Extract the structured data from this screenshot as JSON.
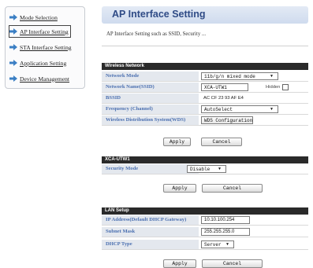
{
  "sidebar": {
    "items": [
      {
        "label": "Mode Selection"
      },
      {
        "label": "AP Interface Setting"
      },
      {
        "label": "STA Interface Setting"
      },
      {
        "label": "Application Setting"
      },
      {
        "label": "Device Management"
      }
    ]
  },
  "main": {
    "title": "AP Interface Setting",
    "description": "AP Interface Setting such as SSID, Security ..."
  },
  "wireless": {
    "header": "Wireless Network",
    "mode_label": "Network Mode",
    "mode_value": "11b/g/n mixed mode",
    "ssid_label": "Network Name(SSID)",
    "ssid_value": "XCA-UTW1",
    "hidden_label": "Hidden",
    "bssid_label": "BSSID",
    "bssid_value": "AC CF 23 93 AF E4",
    "channel_label": "Frequency (Channel)",
    "channel_value": "AutoSelect",
    "wds_label": "Wireless Distribution System(WDS)",
    "wds_value": "WDS Configuration",
    "apply_label": "Apply",
    "cancel_label": "Cancel"
  },
  "security": {
    "header": "XCA-UTW1",
    "mode_label": "Security Mode",
    "mode_value": "Disable",
    "apply_label": "Apply",
    "cancel_label": "Cancel"
  },
  "lan": {
    "header": "LAN Setup",
    "ip_label": "IP Address(Default DHCP Gateway)",
    "ip_value": "10.10.100.254",
    "mask_label": "Subnet Mask",
    "mask_value": "255.255.255.0",
    "dhcp_label": "DHCP Type",
    "dhcp_value": "Server",
    "apply_label": "Apply",
    "cancel_label": "Cancel"
  },
  "colors": {
    "accent": "#2f4b86",
    "label_text": "#4a6fb0",
    "section_header": "#2a2a2a"
  },
  "icons": {
    "sidebar_bullet": "arrow-right-icon"
  }
}
